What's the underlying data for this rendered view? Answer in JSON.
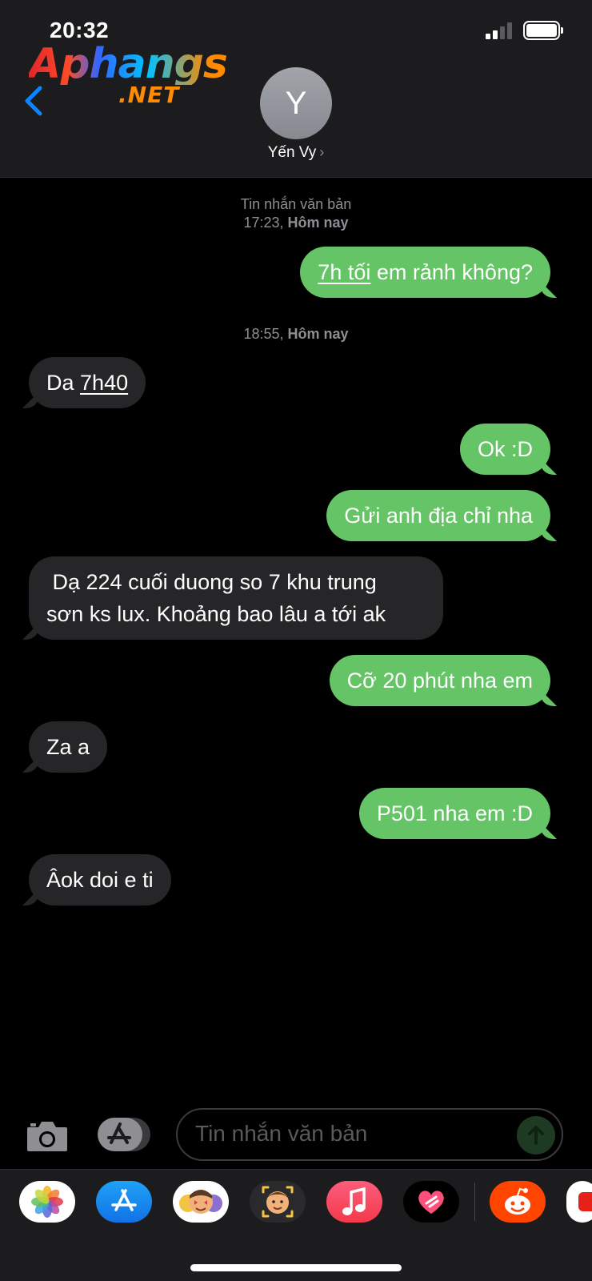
{
  "status_bar": {
    "time": "20:32"
  },
  "watermark": {
    "main": "Aphangs",
    "sub": ".NET"
  },
  "header": {
    "avatar_initial": "Y",
    "contact_name": "Yến Vy",
    "chevron": "›"
  },
  "thread": {
    "meta1": {
      "line1": "Tin nhắn văn bản",
      "time": "17:23,",
      "day": "Hôm nay"
    },
    "meta2": {
      "time": "18:55,",
      "day": "Hôm nay"
    },
    "messages": [
      {
        "id": "m1",
        "dir": "sent",
        "link": "7h tối",
        "text": " em rảnh không?"
      },
      {
        "id": "m2",
        "dir": "recv",
        "text": "Da ",
        "link": "7h40"
      },
      {
        "id": "m3",
        "dir": "sent",
        "text": "Ok :D"
      },
      {
        "id": "m4",
        "dir": "sent",
        "text": "Gửi anh địa chỉ nha"
      },
      {
        "id": "m5",
        "dir": "recv",
        "line1": " Dạ 224 cuối duong so 7 khu trung",
        "line2": "sơn ks lux. Khoảng bao lâu a tới ak"
      },
      {
        "id": "m6",
        "dir": "sent",
        "text": "Cỡ 20 phút nha em"
      },
      {
        "id": "m7",
        "dir": "recv",
        "text": "Za a"
      },
      {
        "id": "m8",
        "dir": "sent",
        "text": "P501 nha em :D"
      },
      {
        "id": "m9",
        "dir": "recv",
        "text": "Âok doi e ti"
      }
    ]
  },
  "composer": {
    "placeholder": "Tin nhắn văn bản"
  },
  "icons": [
    "back-chevron-icon",
    "camera-icon",
    "app-store-icon",
    "send-arrow-icon",
    "photos-icon",
    "memoji-icon",
    "music-icon",
    "digital-touch-icon",
    "reddit-icon"
  ],
  "colors": {
    "sent_bubble": "#65c466",
    "recv_bubble": "#262628",
    "accent": "#0a84ff",
    "header_bg": "#1c1c1e"
  }
}
